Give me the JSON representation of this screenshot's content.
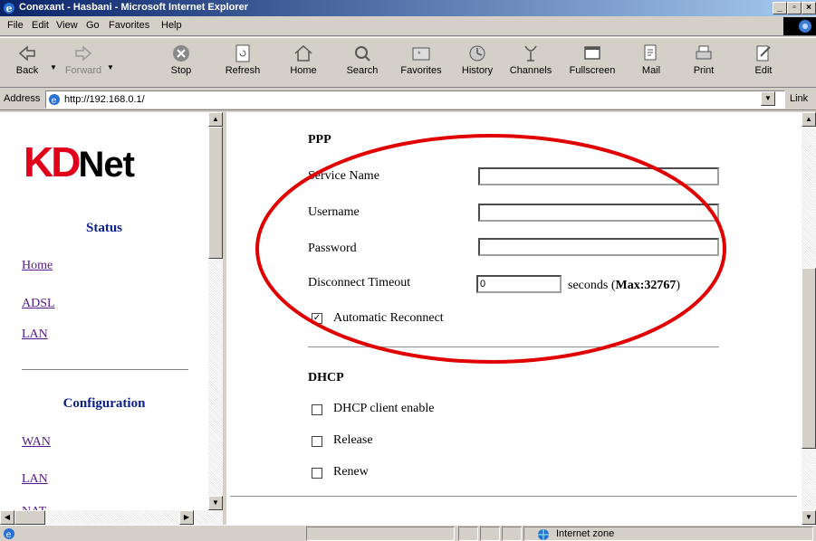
{
  "window": {
    "title": "Conexant - Hasbani - Microsoft Internet Explorer"
  },
  "menu": [
    "File",
    "Edit",
    "View",
    "Go",
    "Favorites",
    "Help"
  ],
  "toolbar": {
    "back": "Back",
    "forward": "Forward",
    "stop": "Stop",
    "refresh": "Refresh",
    "home": "Home",
    "search": "Search",
    "favorites": "Favorites",
    "history": "History",
    "channels": "Channels",
    "fullscreen": "Fullscreen",
    "mail": "Mail",
    "print": "Print",
    "edit": "Edit"
  },
  "address": {
    "label": "Address",
    "url": "http://192.168.0.1/",
    "links": "Link"
  },
  "sidebar": {
    "logo_kd": "KD",
    "logo_net": "Net",
    "status_heading": "Status",
    "status_links": [
      "Home",
      "ADSL",
      "LAN"
    ],
    "config_heading": "Configuration",
    "config_links": [
      "WAN",
      "LAN"
    ]
  },
  "ppp": {
    "title": "PPP",
    "service_name_label": "Service Name",
    "service_name_value": "",
    "username_label": "Username",
    "username_value": "",
    "password_label": "Password",
    "password_value": "",
    "timeout_label": "Disconnect Timeout",
    "timeout_value": "0",
    "seconds_text": "seconds (",
    "max_text": "Max:32767",
    "close_paren": ")",
    "auto_reconnect_label": "Automatic Reconnect",
    "auto_reconnect_checked": true
  },
  "dhcp": {
    "title": "DHCP",
    "client_enable_label": "DHCP client enable",
    "release_label": "Release",
    "renew_label": "Renew"
  },
  "statusbar": {
    "zone": "Internet zone"
  },
  "colors": {
    "annotation_oval": "#e00000",
    "logo_red": "#e0001a",
    "nav_heading": "#0a1f8f",
    "visited_link": "#551a8b"
  }
}
